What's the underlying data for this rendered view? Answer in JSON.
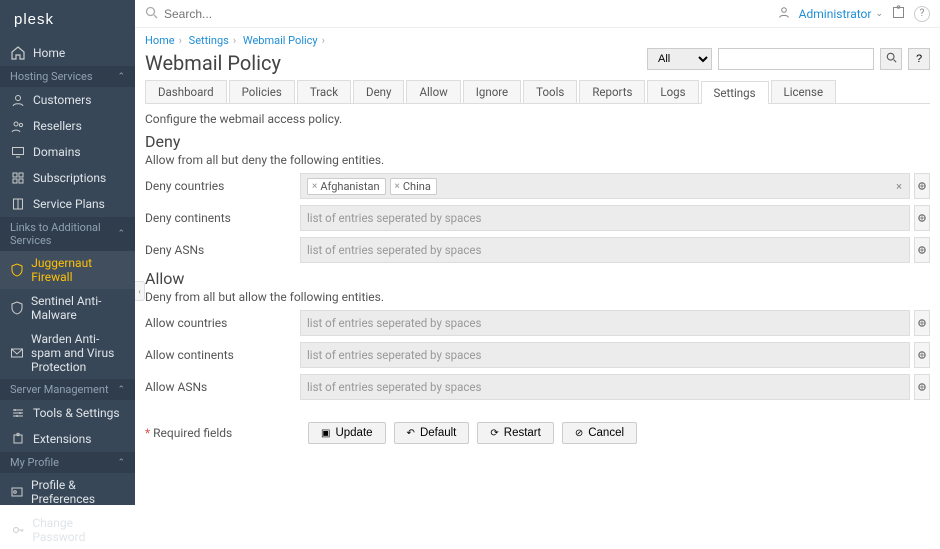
{
  "brand": "plesk",
  "search_placeholder": "Search...",
  "user": {
    "name": "Administrator"
  },
  "sidebar": {
    "home": "Home",
    "sections": {
      "hosting": "Hosting Services",
      "links": "Links to Additional Services",
      "server": "Server Management",
      "profile": "My Profile"
    },
    "hosting_items": [
      "Customers",
      "Resellers",
      "Domains",
      "Subscriptions",
      "Service Plans"
    ],
    "links_items": [
      "Juggernaut Firewall",
      "Sentinel Anti-Malware",
      "Warden Anti-spam and Virus Protection"
    ],
    "server_items": [
      "Tools & Settings",
      "Extensions"
    ],
    "profile_items": [
      "Profile & Preferences",
      "Change Password"
    ]
  },
  "crumbs": [
    "Home",
    "Settings",
    "Webmail Policy"
  ],
  "title": "Webmail Policy",
  "filter": {
    "all": "All",
    "search_btn": "search",
    "help_btn": "?"
  },
  "tabs": [
    "Dashboard",
    "Policies",
    "Track",
    "Deny",
    "Allow",
    "Ignore",
    "Tools",
    "Reports",
    "Logs",
    "Settings",
    "License"
  ],
  "active_tab": "Settings",
  "intro": "Configure the webmail access policy.",
  "deny": {
    "head": "Deny",
    "desc": "Allow from all but deny the following entities.",
    "countries_label": "Deny countries",
    "countries": [
      "Afghanistan",
      "China"
    ],
    "continents_label": "Deny continents",
    "asns_label": "Deny ASNs"
  },
  "allow": {
    "head": "Allow",
    "desc": "Deny from all but allow the following entities.",
    "countries_label": "Allow countries",
    "continents_label": "Allow continents",
    "asns_label": "Allow ASNs"
  },
  "placeholder": "list of entries seperated by spaces",
  "required": "Required fields",
  "buttons": {
    "update": "Update",
    "default": "Default",
    "restart": "Restart",
    "cancel": "Cancel"
  }
}
